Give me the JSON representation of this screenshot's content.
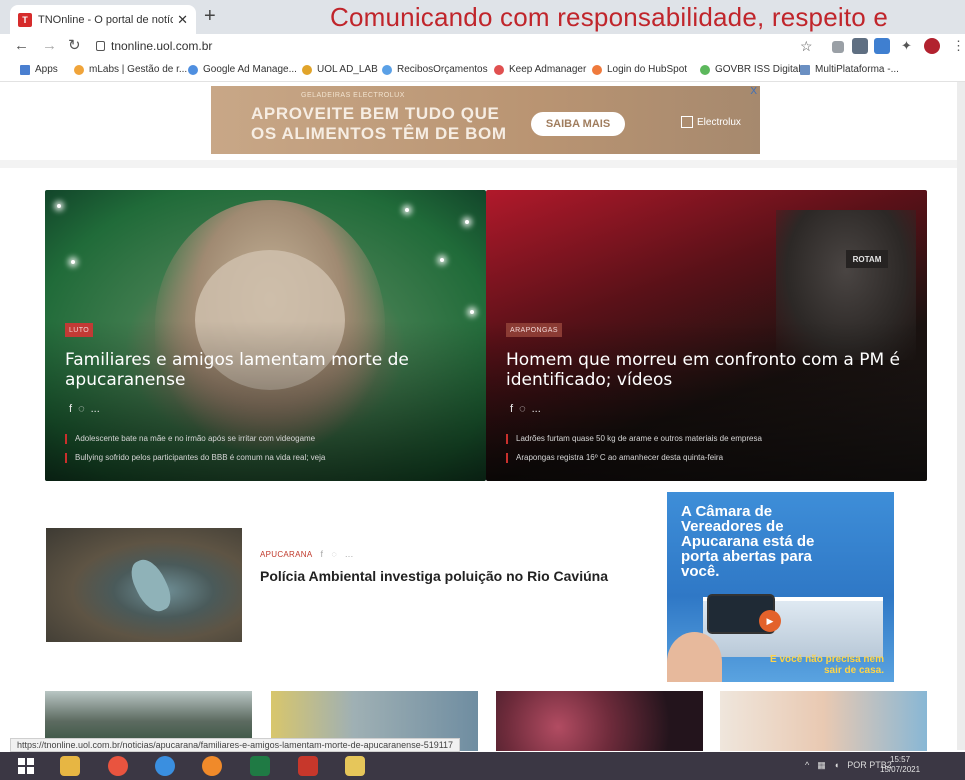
{
  "browser": {
    "tab_title": "TNOnline - O portal de notícias",
    "tab_close": "✕",
    "new_tab": "+",
    "overlay_banner": "Comunicando com responsabilidade, respeito e",
    "url": "tnonline.uol.com.br",
    "bookmarks": [
      "Apps",
      "mLabs | Gestão de r...",
      "Google Ad Manage...",
      "UOL AD_LAB",
      "RecibosOrçamentos",
      "Keep Admanager",
      "Login do HubSpot",
      "GOVBR ISS Digital",
      "MultiPlataforma -..."
    ],
    "status_url": "https://tnonline.uol.com.br/noticias/apucarana/familiares-e-amigos-lamentam-morte-de-apucaranense-519117"
  },
  "top_ad": {
    "small": "GELADEIRAS ELECTROLUX",
    "line1": "APROVEITE BEM TUDO QUE",
    "line2": "OS ALIMENTOS TÊM DE BOM",
    "button": "SAIBA MAIS",
    "brand": "Electrolux",
    "close": "X"
  },
  "featured": [
    {
      "tag": "LUTO",
      "title": "Familiares e amigos lamentam morte de apucaranense",
      "links": [
        "Adolescente bate na mãe e no irmão após se irritar com videogame",
        "Bullying sofrido pelos participantes do BBB é comum na vida real; veja"
      ]
    },
    {
      "tag": "ARAPONGAS",
      "title": "Homem que morreu em confronto com a PM é identificado; vídeos",
      "links": [
        "Ladrões furtam quase 50 kg de arame e outros materiais de empresa",
        "Arapongas registra 16º C ao amanhecer desta quinta-feira"
      ]
    }
  ],
  "social": {
    "facebook": "f",
    "whatsapp": "◌",
    "more": "..."
  },
  "story": {
    "category": "APUCARANA",
    "title": "Polícia Ambiental investiga poluição no Rio Caviúna"
  },
  "camara_ad": {
    "headline": "A Câmara de Vereadores de Apucarana está de porta abertas para você.",
    "sub": "E você não precisa nem sair de casa."
  },
  "police_tag": "ROTAM",
  "taskbar": {
    "tray": "POR PTB2",
    "time": "15:57",
    "date": "15/07/2021"
  },
  "colors": {
    "accent_red": "#c0252b",
    "camara_blue": "#2f78c6"
  }
}
